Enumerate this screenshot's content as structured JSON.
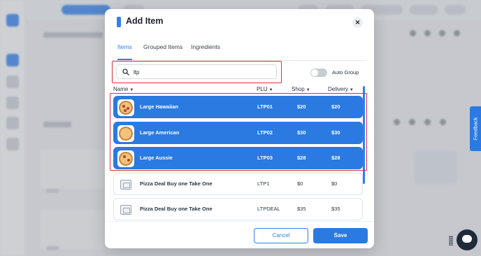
{
  "modal": {
    "title": "Add Item",
    "close_glyph": "✕",
    "tabs": [
      {
        "label": "Items",
        "active": true
      },
      {
        "label": "Grouped Items",
        "active": false
      },
      {
        "label": "Ingredients",
        "active": false
      }
    ],
    "search": {
      "value": "ltp",
      "icon": "search-icon"
    },
    "auto_group": {
      "label": "Auto Group",
      "enabled": false
    },
    "columns": {
      "name": "Name",
      "plu": "PLU",
      "shop": "Shop",
      "delivery": "Delivery"
    },
    "rows": [
      {
        "name": "Large Hawaiian",
        "plu": "LTP01",
        "shop": "$20",
        "delivery": "$20",
        "selected": true,
        "image": "pizza"
      },
      {
        "name": "Large American",
        "plu": "LTP02",
        "shop": "$30",
        "delivery": "$30",
        "selected": true,
        "image": "pizza"
      },
      {
        "name": "Large Aussie",
        "plu": "LTP03",
        "shop": "$28",
        "delivery": "$28",
        "selected": true,
        "image": "pizza"
      },
      {
        "name": "Pizza Deal Buy one Take One",
        "plu": "LTP1",
        "shop": "$0",
        "delivery": "$0",
        "selected": false,
        "image": "placeholder"
      },
      {
        "name": "Pizza Deal Buy one Take One",
        "plu": "LTPDEAL",
        "shop": "$35",
        "delivery": "$35",
        "selected": false,
        "image": "placeholder"
      }
    ],
    "buttons": {
      "cancel": "Cancel",
      "save": "Save"
    }
  },
  "feedback_label": "Feedback",
  "colors": {
    "accent": "#2a7ae2",
    "highlight": "#e03131"
  }
}
